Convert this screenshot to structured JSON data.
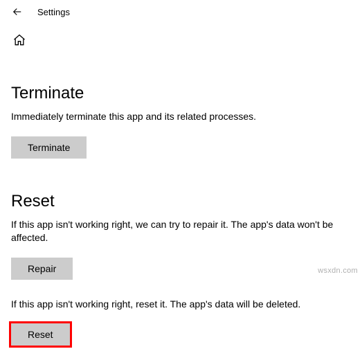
{
  "header": {
    "title": "Settings"
  },
  "terminate": {
    "heading": "Terminate",
    "description": "Immediately terminate this app and its related processes.",
    "button_label": "Terminate"
  },
  "reset": {
    "heading": "Reset",
    "repair_description": "If this app isn't working right, we can try to repair it. The app's data won't be affected.",
    "repair_button_label": "Repair",
    "reset_description": "If this app isn't working right, reset it. The app's data will be deleted.",
    "reset_button_label": "Reset"
  },
  "watermark": "wsxdn.com"
}
